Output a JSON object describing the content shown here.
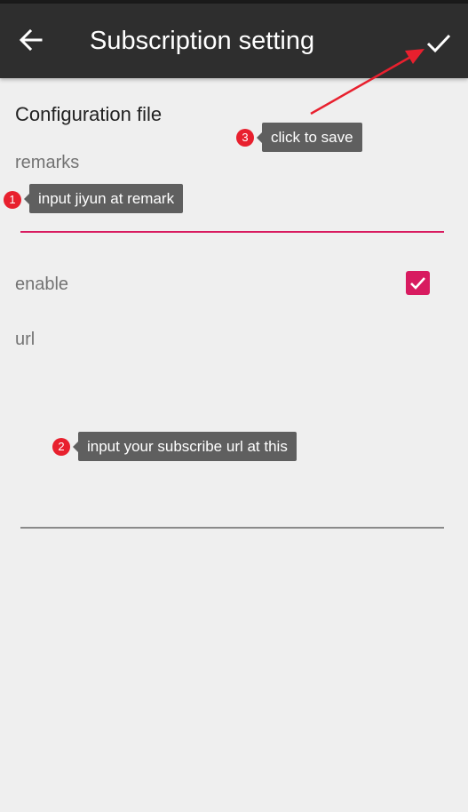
{
  "appbar": {
    "title": "Subscription setting",
    "back_icon": "arrow-left-icon",
    "save_icon": "check-icon"
  },
  "form": {
    "section_title": "Configuration file",
    "remarks": {
      "label": "remarks",
      "value": ""
    },
    "enable": {
      "label": "enable",
      "checked": true
    },
    "url": {
      "label": "url",
      "value": ""
    }
  },
  "annotations": [
    {
      "number": "1",
      "text": "input  jiyun at remark"
    },
    {
      "number": "2",
      "text": "input your subscribe url at this"
    },
    {
      "number": "3",
      "text": "click to save"
    }
  ],
  "colors": {
    "accent": "#d81b60",
    "appbar": "#2e2e2e",
    "background": "#efefef",
    "annotation_badge": "#e8202e",
    "annotation_note": "#5f5f5f",
    "annotation_arrow": "#e8202e"
  }
}
